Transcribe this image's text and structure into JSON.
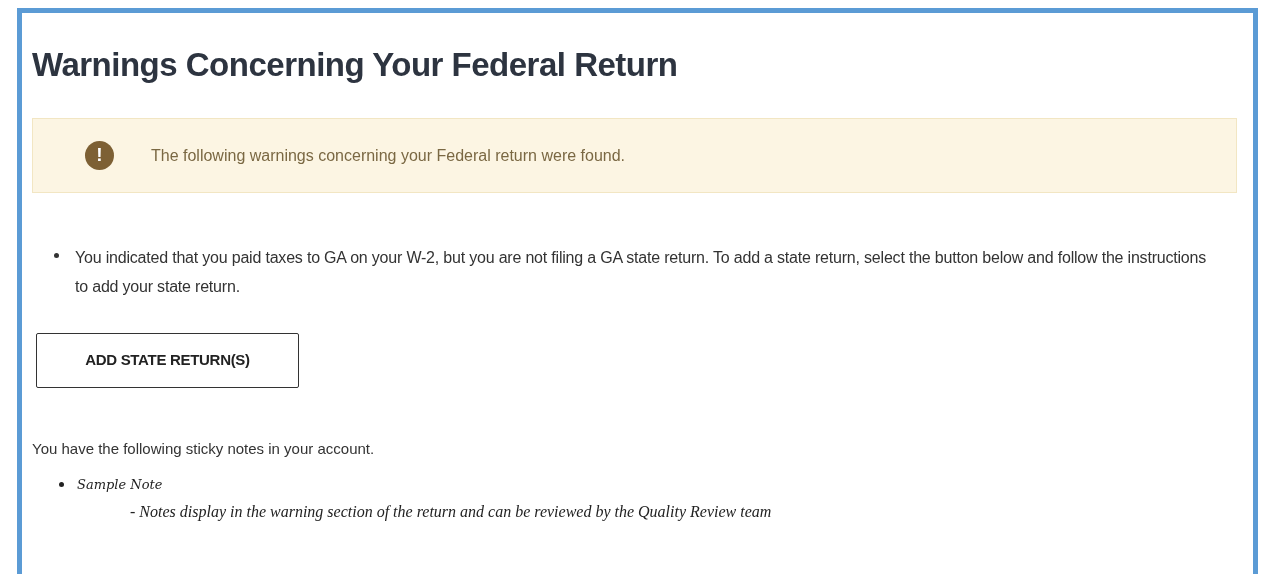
{
  "heading": "Warnings Concerning Your Federal Return",
  "alert": {
    "icon": "!",
    "message": "The following warnings concerning your Federal return were found."
  },
  "warnings": [
    "You indicated that you paid taxes to GA on your W-2, but you are not filing a GA state return. To add a state return, select the button below and follow the instructions to add your state return."
  ],
  "add_button": "ADD STATE RETURN(S)",
  "notes_intro": "You have the following sticky notes in your account.",
  "notes": [
    {
      "title": "Sample Note",
      "text": "- Notes display in the warning section of the return and can be reviewed by the Quality Review team"
    }
  ]
}
